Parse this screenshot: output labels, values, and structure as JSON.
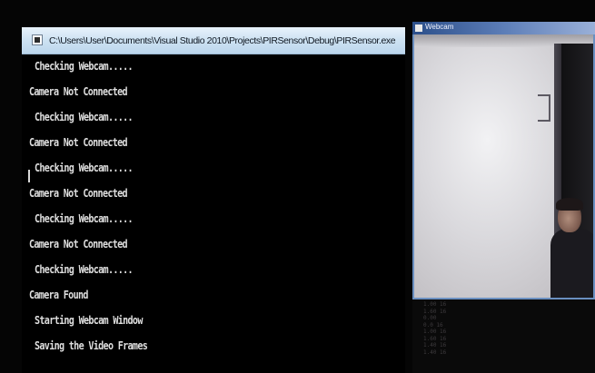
{
  "console": {
    "title": "C:\\Users\\User\\Documents\\Visual Studio 2010\\Projects\\PIRSensor\\Debug\\PIRSensor.exe",
    "lines": [
      "Checking Webcam.....",
      "Camera Not Connected",
      "Checking Webcam.....",
      "Camera Not Connected",
      "Checking Webcam.....",
      "Camera Not Connected",
      "Checking Webcam.....",
      "Camera Not Connected",
      "Checking Webcam.....",
      "Camera Found",
      "Starting Webcam Window",
      "Saving the Video Frames"
    ]
  },
  "webcam": {
    "title": "Webcam",
    "reflection_lines": [
      "1.00 16",
      "1.60 16",
      "0.00",
      "0.0 16",
      "1.00 16",
      "1.60 16",
      "1.40 16",
      "1.40 16"
    ]
  },
  "colors": {
    "console_bg": "#000000",
    "console_text": "#dfdfdf",
    "titlebar_light": "#e8f2fb",
    "titlebar_dark": "#bcd6ec",
    "webcam_titlebar": "#2c4f8a",
    "webcam_border": "#6a8fc0"
  }
}
